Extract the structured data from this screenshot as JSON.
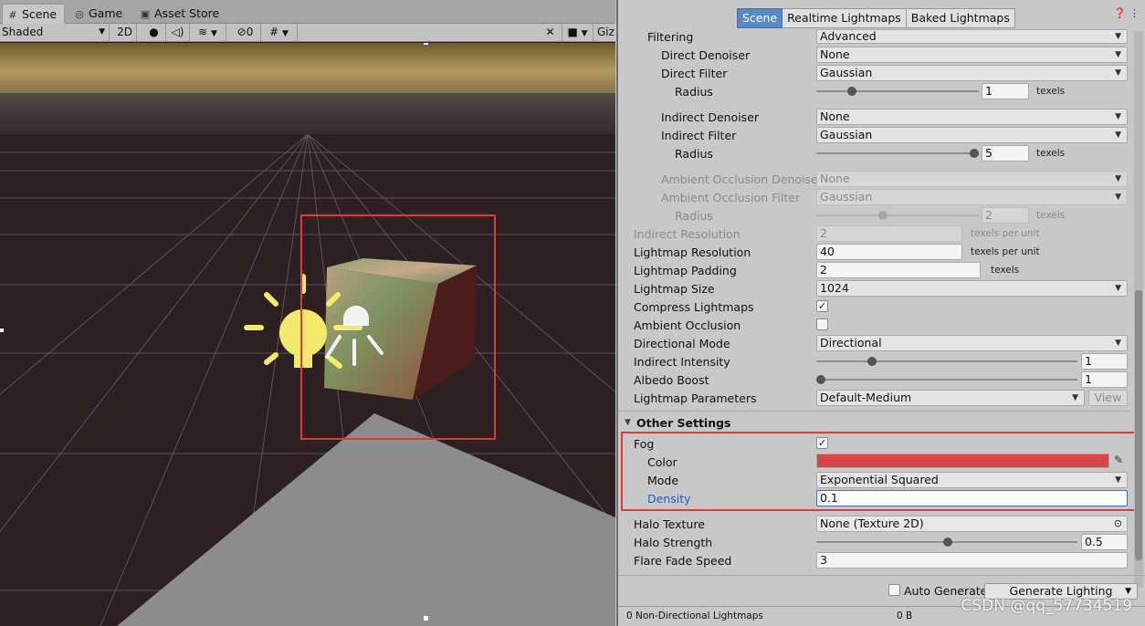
{
  "scene_tabs": [
    {
      "label": "Scene",
      "icon": "grid-icon"
    },
    {
      "label": "Game",
      "icon": "gamepad-icon"
    },
    {
      "label": "Asset Store",
      "icon": "store-icon"
    }
  ],
  "scene_toolbar": {
    "draw_mode": "Shaded",
    "mode_2d": "2D",
    "hidden_count": "0",
    "gizmos": "Giz"
  },
  "lighting_tabs": [
    "Scene",
    "Realtime Lightmaps",
    "Baked Lightmaps"
  ],
  "filtering": {
    "label": "Filtering",
    "value": "Advanced",
    "direct_denoiser": {
      "label": "Direct Denoiser",
      "value": "None"
    },
    "direct_filter": {
      "label": "Direct Filter",
      "value": "Gaussian"
    },
    "direct_radius": {
      "label": "Radius",
      "value": "1",
      "unit": "texels"
    },
    "indirect_denoiser": {
      "label": "Indirect Denoiser",
      "value": "None"
    },
    "indirect_filter": {
      "label": "Indirect Filter",
      "value": "Gaussian"
    },
    "indirect_radius": {
      "label": "Radius",
      "value": "5",
      "unit": "texels"
    },
    "ao_denoiser": {
      "label": "Ambient Occlusion Denoiser",
      "value": "None"
    },
    "ao_filter": {
      "label": "Ambient Occlusion Filter",
      "value": "Gaussian"
    },
    "ao_radius": {
      "label": "Radius",
      "value": "2",
      "unit": "texels"
    }
  },
  "lightmap": {
    "indirect_resolution": {
      "label": "Indirect Resolution",
      "value": "2",
      "unit": "texels per unit"
    },
    "resolution": {
      "label": "Lightmap Resolution",
      "value": "40",
      "unit": "texels per unit"
    },
    "padding": {
      "label": "Lightmap Padding",
      "value": "2",
      "unit": "texels"
    },
    "size": {
      "label": "Lightmap Size",
      "value": "1024"
    },
    "compress": {
      "label": "Compress Lightmaps",
      "checked": true
    },
    "ambient_occlusion": {
      "label": "Ambient Occlusion",
      "checked": false
    },
    "directional_mode": {
      "label": "Directional Mode",
      "value": "Directional"
    },
    "indirect_intensity": {
      "label": "Indirect Intensity",
      "value": "1"
    },
    "albedo_boost": {
      "label": "Albedo Boost",
      "value": "1"
    },
    "parameters": {
      "label": "Lightmap Parameters",
      "value": "Default-Medium",
      "view_label": "View"
    }
  },
  "other_settings": {
    "header": "Other Settings",
    "fog": {
      "label": "Fog",
      "checked": true
    },
    "color": {
      "label": "Color",
      "value": "#d94444"
    },
    "mode": {
      "label": "Mode",
      "value": "Exponential Squared"
    },
    "density": {
      "label": "Density",
      "value": "0.1"
    },
    "halo_texture": {
      "label": "Halo Texture",
      "value": "None (Texture 2D)"
    },
    "halo_strength": {
      "label": "Halo Strength",
      "value": "0.5"
    },
    "flare_fade_speed": {
      "label": "Flare Fade Speed",
      "value": "3"
    }
  },
  "footer": {
    "auto_generate": {
      "label": "Auto Generate",
      "checked": false
    },
    "generate_button": "Generate Lighting"
  },
  "status": {
    "lightmaps": "0 Non-Directional Lightmaps",
    "size": "0 B"
  },
  "watermark": "CSDN @qq_57734519",
  "colors": {
    "highlight_box": "#e03a3a",
    "active_tab": "#5a8ac6",
    "fog_color": "#d94444"
  }
}
